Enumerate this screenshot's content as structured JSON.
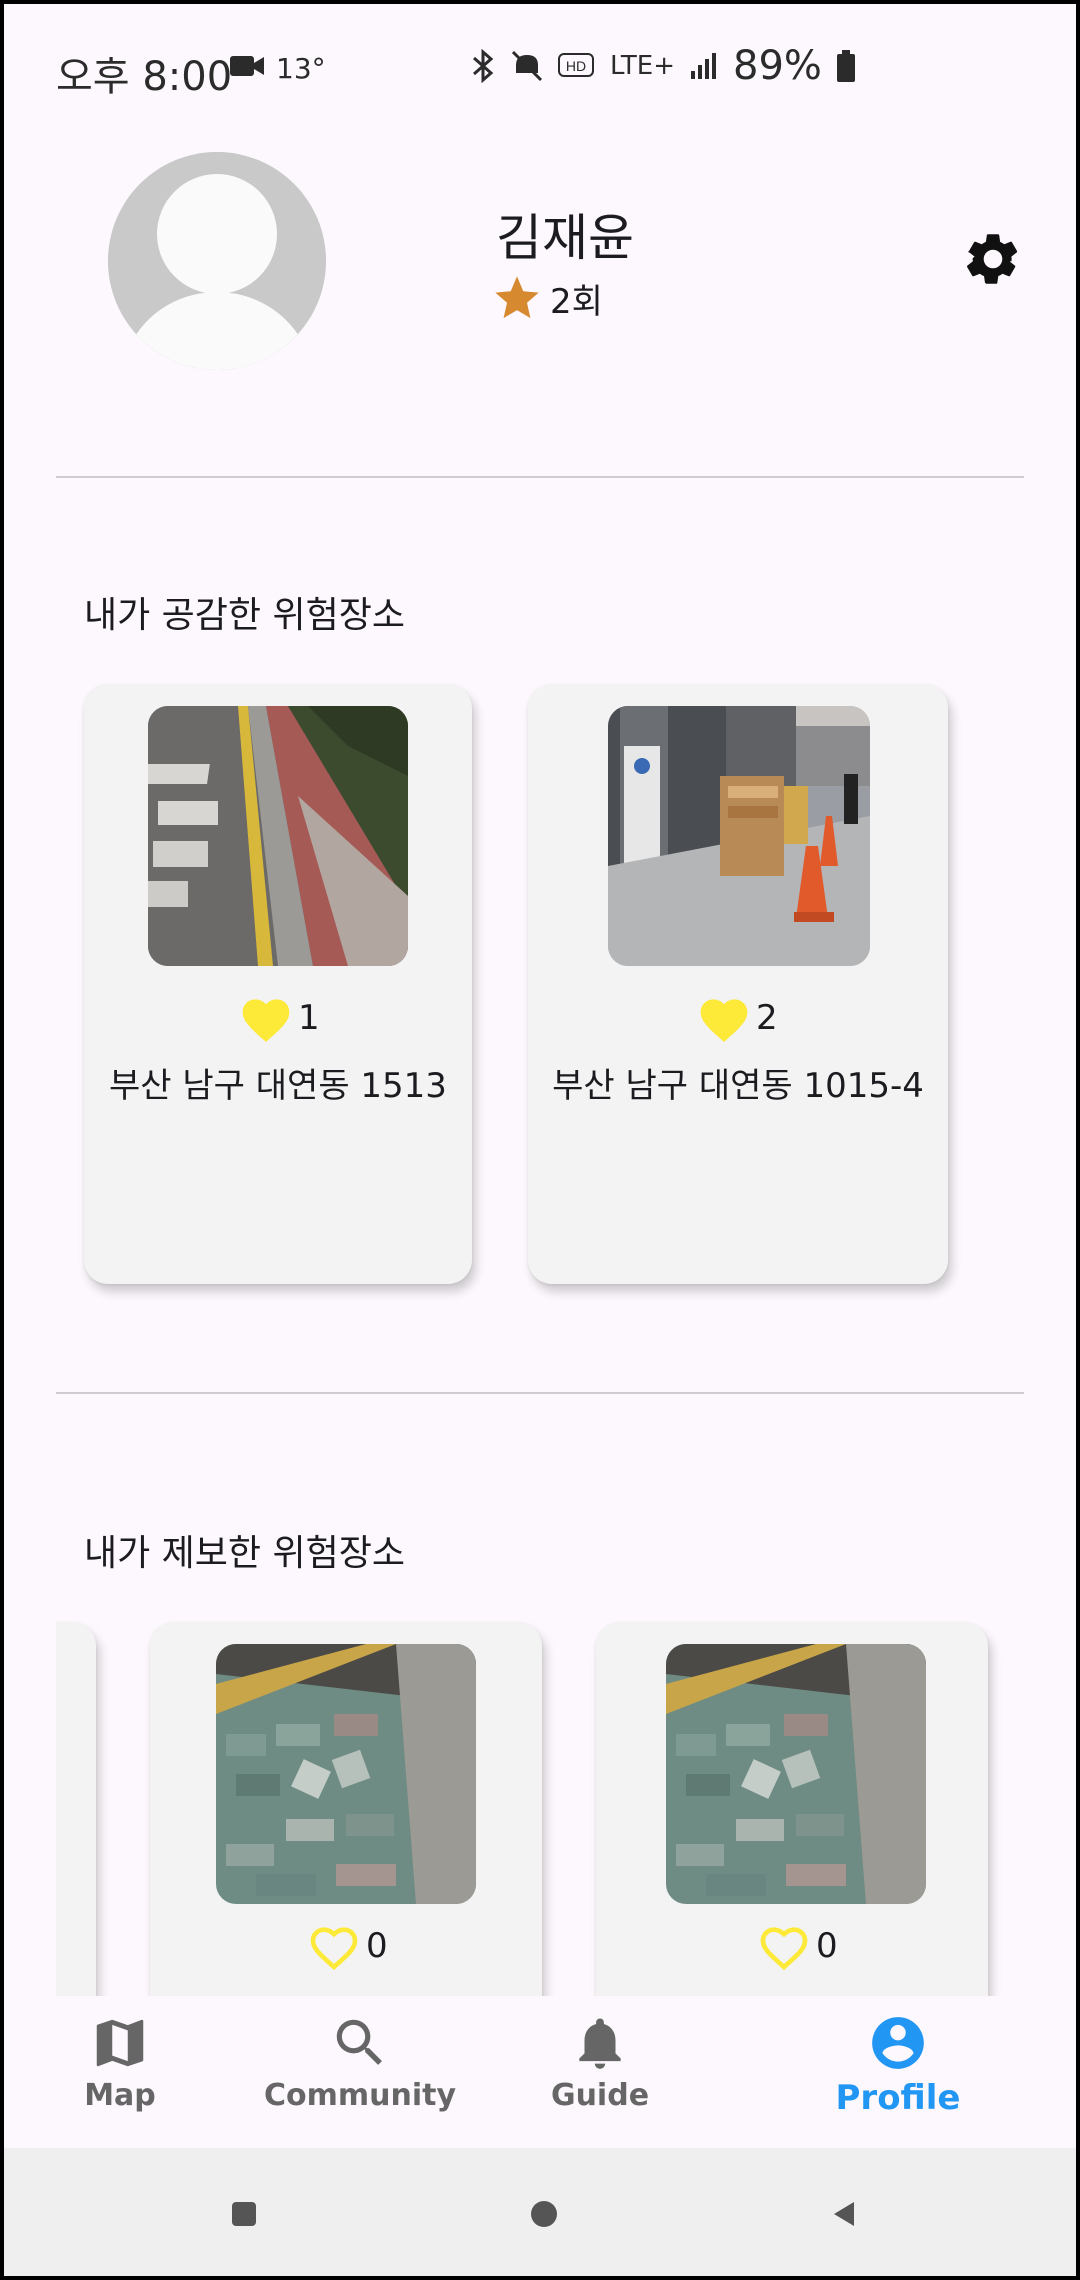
{
  "status_bar": {
    "time": "오후 8:00",
    "temperature": "13°",
    "network": "LTE+",
    "battery": "89%",
    "icons": [
      "video-icon",
      "bluetooth-icon",
      "mute-icon",
      "hd-icon",
      "lte-icon",
      "signal-icon",
      "battery-icon"
    ]
  },
  "profile": {
    "name": "김재윤",
    "report_count": "2회",
    "avatar": "avatar-placeholder-icon",
    "settings_icon": "gear-icon"
  },
  "liked_section": {
    "title": "내가 공감한 위험장소",
    "cards": [
      {
        "likes": "1",
        "liked": true,
        "address": "부산 남구 대연동 1513"
      },
      {
        "likes": "2",
        "liked": true,
        "address": "부산 남구 대연동 1015-4"
      }
    ]
  },
  "reported_section": {
    "title": "내가 제보한 위험장소",
    "cards": [
      {
        "likes": "0",
        "liked": false
      },
      {
        "likes": "0",
        "liked": false
      }
    ]
  },
  "bottom_nav": {
    "items": [
      {
        "label": "Map",
        "icon": "map-icon"
      },
      {
        "label": "Community",
        "icon": "search-icon"
      },
      {
        "label": "Guide",
        "icon": "bell-icon"
      },
      {
        "label": "Profile",
        "icon": "account-circle-icon",
        "active": true
      }
    ]
  },
  "colors": {
    "background": "#fcf8fd",
    "accent": "#2196f3",
    "heart": "#fde937",
    "star": "#d7892f",
    "card": "#f3f3f3"
  }
}
